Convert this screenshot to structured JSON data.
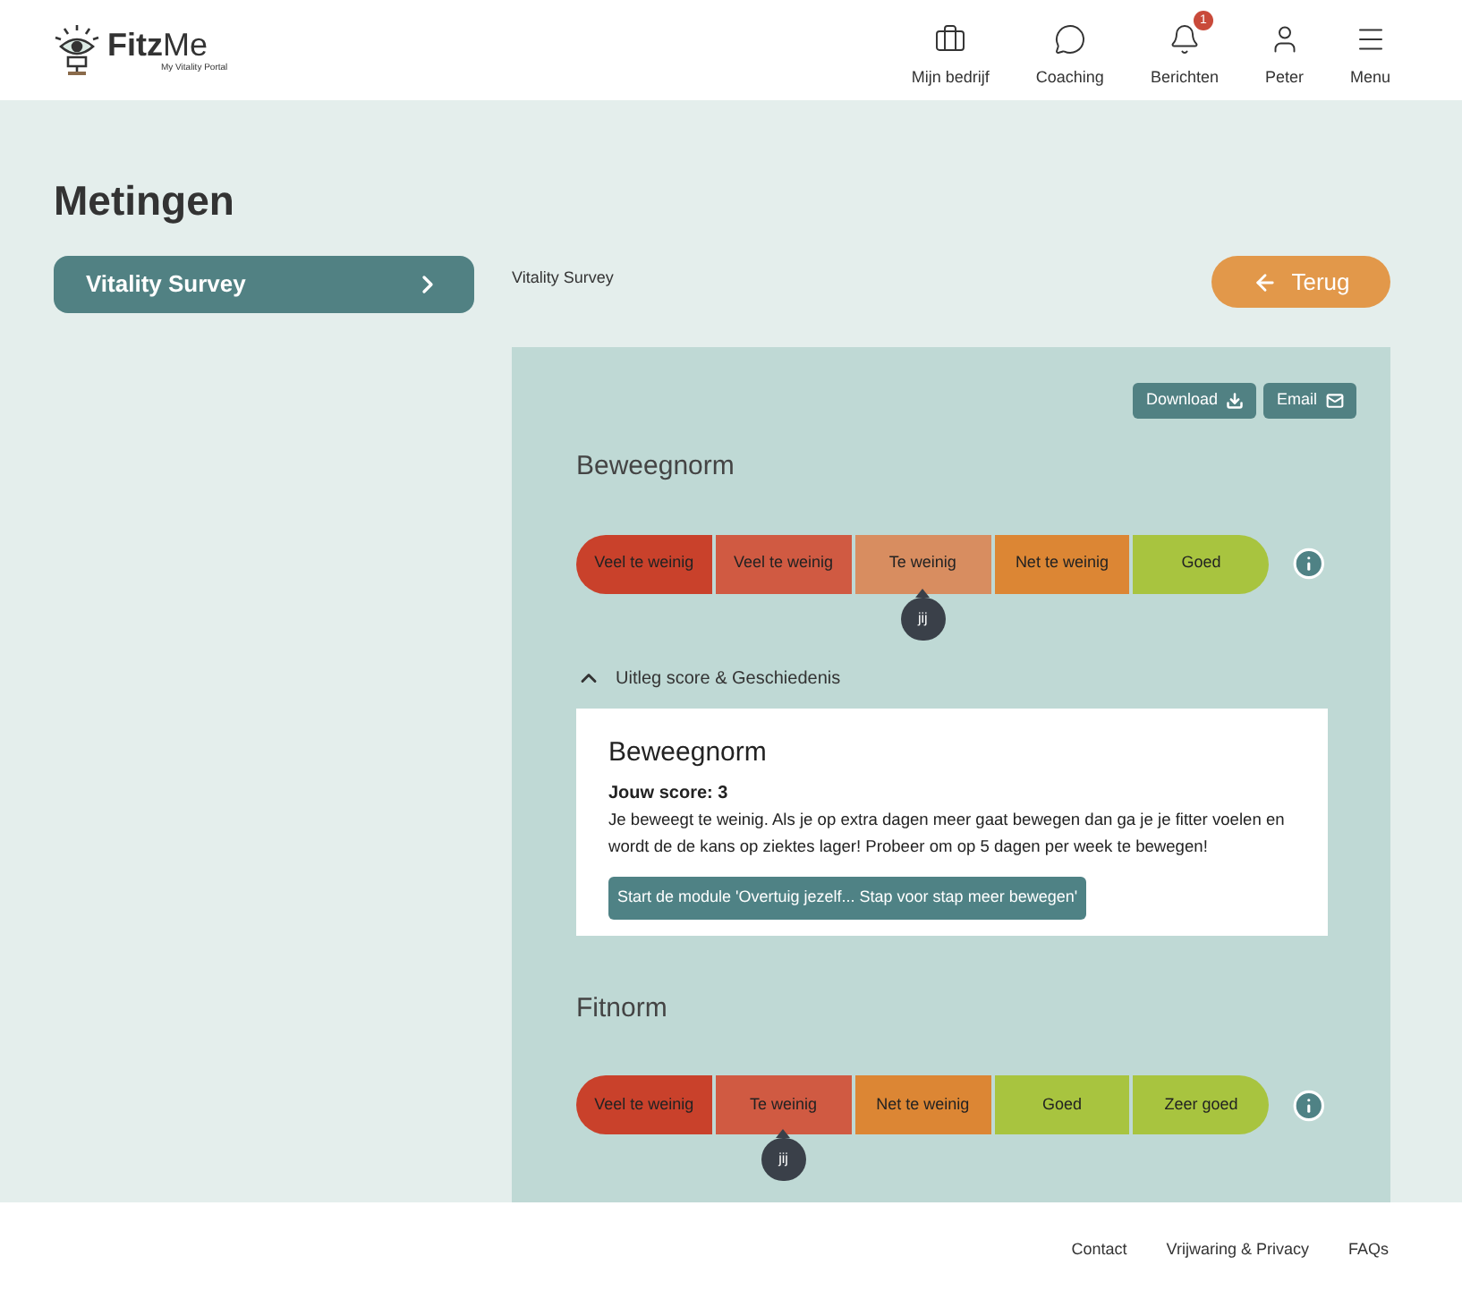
{
  "header": {
    "logo": "**Fitz**Me",
    "logo_subtitle": "My Vitality Portal",
    "nav": [
      {
        "kind": "briefcase",
        "label": "Mijn bedrijf"
      },
      {
        "kind": "chat",
        "label": "Coaching"
      },
      {
        "kind": "bell",
        "label": "Berichten",
        "badge": "1"
      },
      {
        "kind": "user",
        "label": "Peter"
      },
      {
        "kind": "menu",
        "label": "Menu"
      }
    ]
  },
  "page_title": "Metingen",
  "sidebar": {
    "items": [
      {
        "label": "Vitality Survey",
        "selected": true
      }
    ]
  },
  "breadcrumb": "Vitality Survey",
  "back_button": "Terug",
  "actions": [
    {
      "kind": "download",
      "label": "Download"
    },
    {
      "kind": "email",
      "label": "Email"
    }
  ],
  "measures": [
    {
      "title": "Beweegnorm",
      "marker": "jij",
      "segments": [
        {
          "label": "Veel te weinig",
          "color": "#c9412b",
          "selected": false
        },
        {
          "label": "Veel te weinig",
          "color": "#d05a42",
          "selected": false
        },
        {
          "label": "Te weinig",
          "color": "#d88d60",
          "selected": true
        },
        {
          "label": "Net te weinig",
          "color": "#dc8634",
          "selected": false
        },
        {
          "label": "Goed",
          "color": "#a8c43f",
          "selected": false
        }
      ],
      "toggle": {
        "label": "Uitleg score & Geschiedenis",
        "expanded": true
      },
      "detail": {
        "title": "Beweegnorm",
        "score": "Jouw score: 3",
        "text": "Je beweegt te weinig. Als je op extra dagen meer gaat bewegen dan ga je je fitter voelen en wordt de de kans op ziektes lager! Probeer om op 5 dagen per week te bewegen!",
        "button": "Start de module 'Overtuig jezelf... Stap voor stap meer bewegen'"
      }
    },
    {
      "title": "Fitnorm",
      "marker": "jij",
      "segments": [
        {
          "label": "Veel te weinig",
          "color": "#c9412b",
          "selected": false
        },
        {
          "label": "Te weinig",
          "color": "#d05a42",
          "selected": true
        },
        {
          "label": "Net te weinig",
          "color": "#dc8634",
          "selected": false
        },
        {
          "label": "Goed",
          "color": "#a8c43f",
          "selected": false
        },
        {
          "label": "Zeer goed",
          "color": "#a8c43f",
          "selected": false
        }
      ]
    }
  ],
  "footer": {
    "links": [
      "Contact",
      "Vrijwaring & Privacy",
      "FAQs"
    ]
  }
}
